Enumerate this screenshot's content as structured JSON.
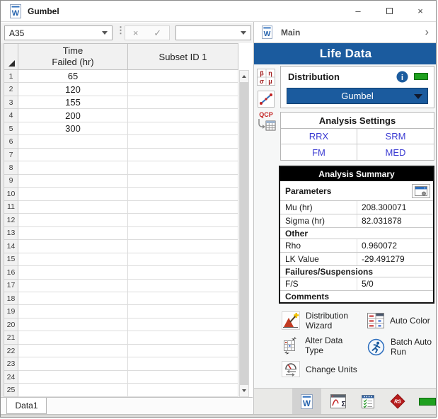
{
  "colors": {
    "brand_blue": "#1b5b9e",
    "link_blue": "#3a3ad2",
    "status_green": "#1fa01f",
    "summary_header_bg": "#000000",
    "accent_red": "#c32020"
  },
  "window": {
    "title": "Gumbel"
  },
  "formula_bar": {
    "cell_ref": "A35",
    "cancel": "×",
    "confirm": "✓",
    "formula_value": ""
  },
  "grid": {
    "col_a_header": "Time\nFailed (hr)",
    "col_b_header": "Subset ID 1",
    "row_count": 25,
    "values": [
      "65",
      "120",
      "155",
      "200",
      "300"
    ],
    "sheet_tab": "Data1"
  },
  "panel": {
    "nav_label": "Main",
    "nav_chevron": "›",
    "title": "Life Data",
    "qcp_label": "QCP",
    "greek_letters": [
      "β",
      "η",
      "σ",
      "μ"
    ],
    "distribution": {
      "label": "Distribution",
      "value": "Gumbel"
    },
    "analysis_settings": {
      "title": "Analysis Settings",
      "options": [
        "RRX",
        "SRM",
        "FM",
        "MED"
      ]
    },
    "analysis_summary": {
      "title": "Analysis Summary",
      "rows": [
        {
          "type": "section",
          "label": "Parameters",
          "has_icon": true
        },
        {
          "type": "data",
          "label": "Mu (hr)",
          "value": "208.300071"
        },
        {
          "type": "data",
          "label": "Sigma (hr)",
          "value": "82.031878"
        },
        {
          "type": "section",
          "label": "Other"
        },
        {
          "type": "data",
          "label": "Rho",
          "value": "0.960072"
        },
        {
          "type": "data",
          "label": "LK Value",
          "value": "-29.491279"
        },
        {
          "type": "section",
          "label": "Failures/Suspensions"
        },
        {
          "type": "data",
          "label": "F/S",
          "value": "5/0"
        },
        {
          "type": "section",
          "label": "Comments"
        }
      ]
    },
    "actions": [
      {
        "label": "Distribution\nWizard"
      },
      {
        "label": "Alter Data\nType"
      },
      {
        "label": "Change Units"
      },
      {
        "label": "Auto Color"
      },
      {
        "label": "Batch Auto\nRun"
      }
    ]
  }
}
